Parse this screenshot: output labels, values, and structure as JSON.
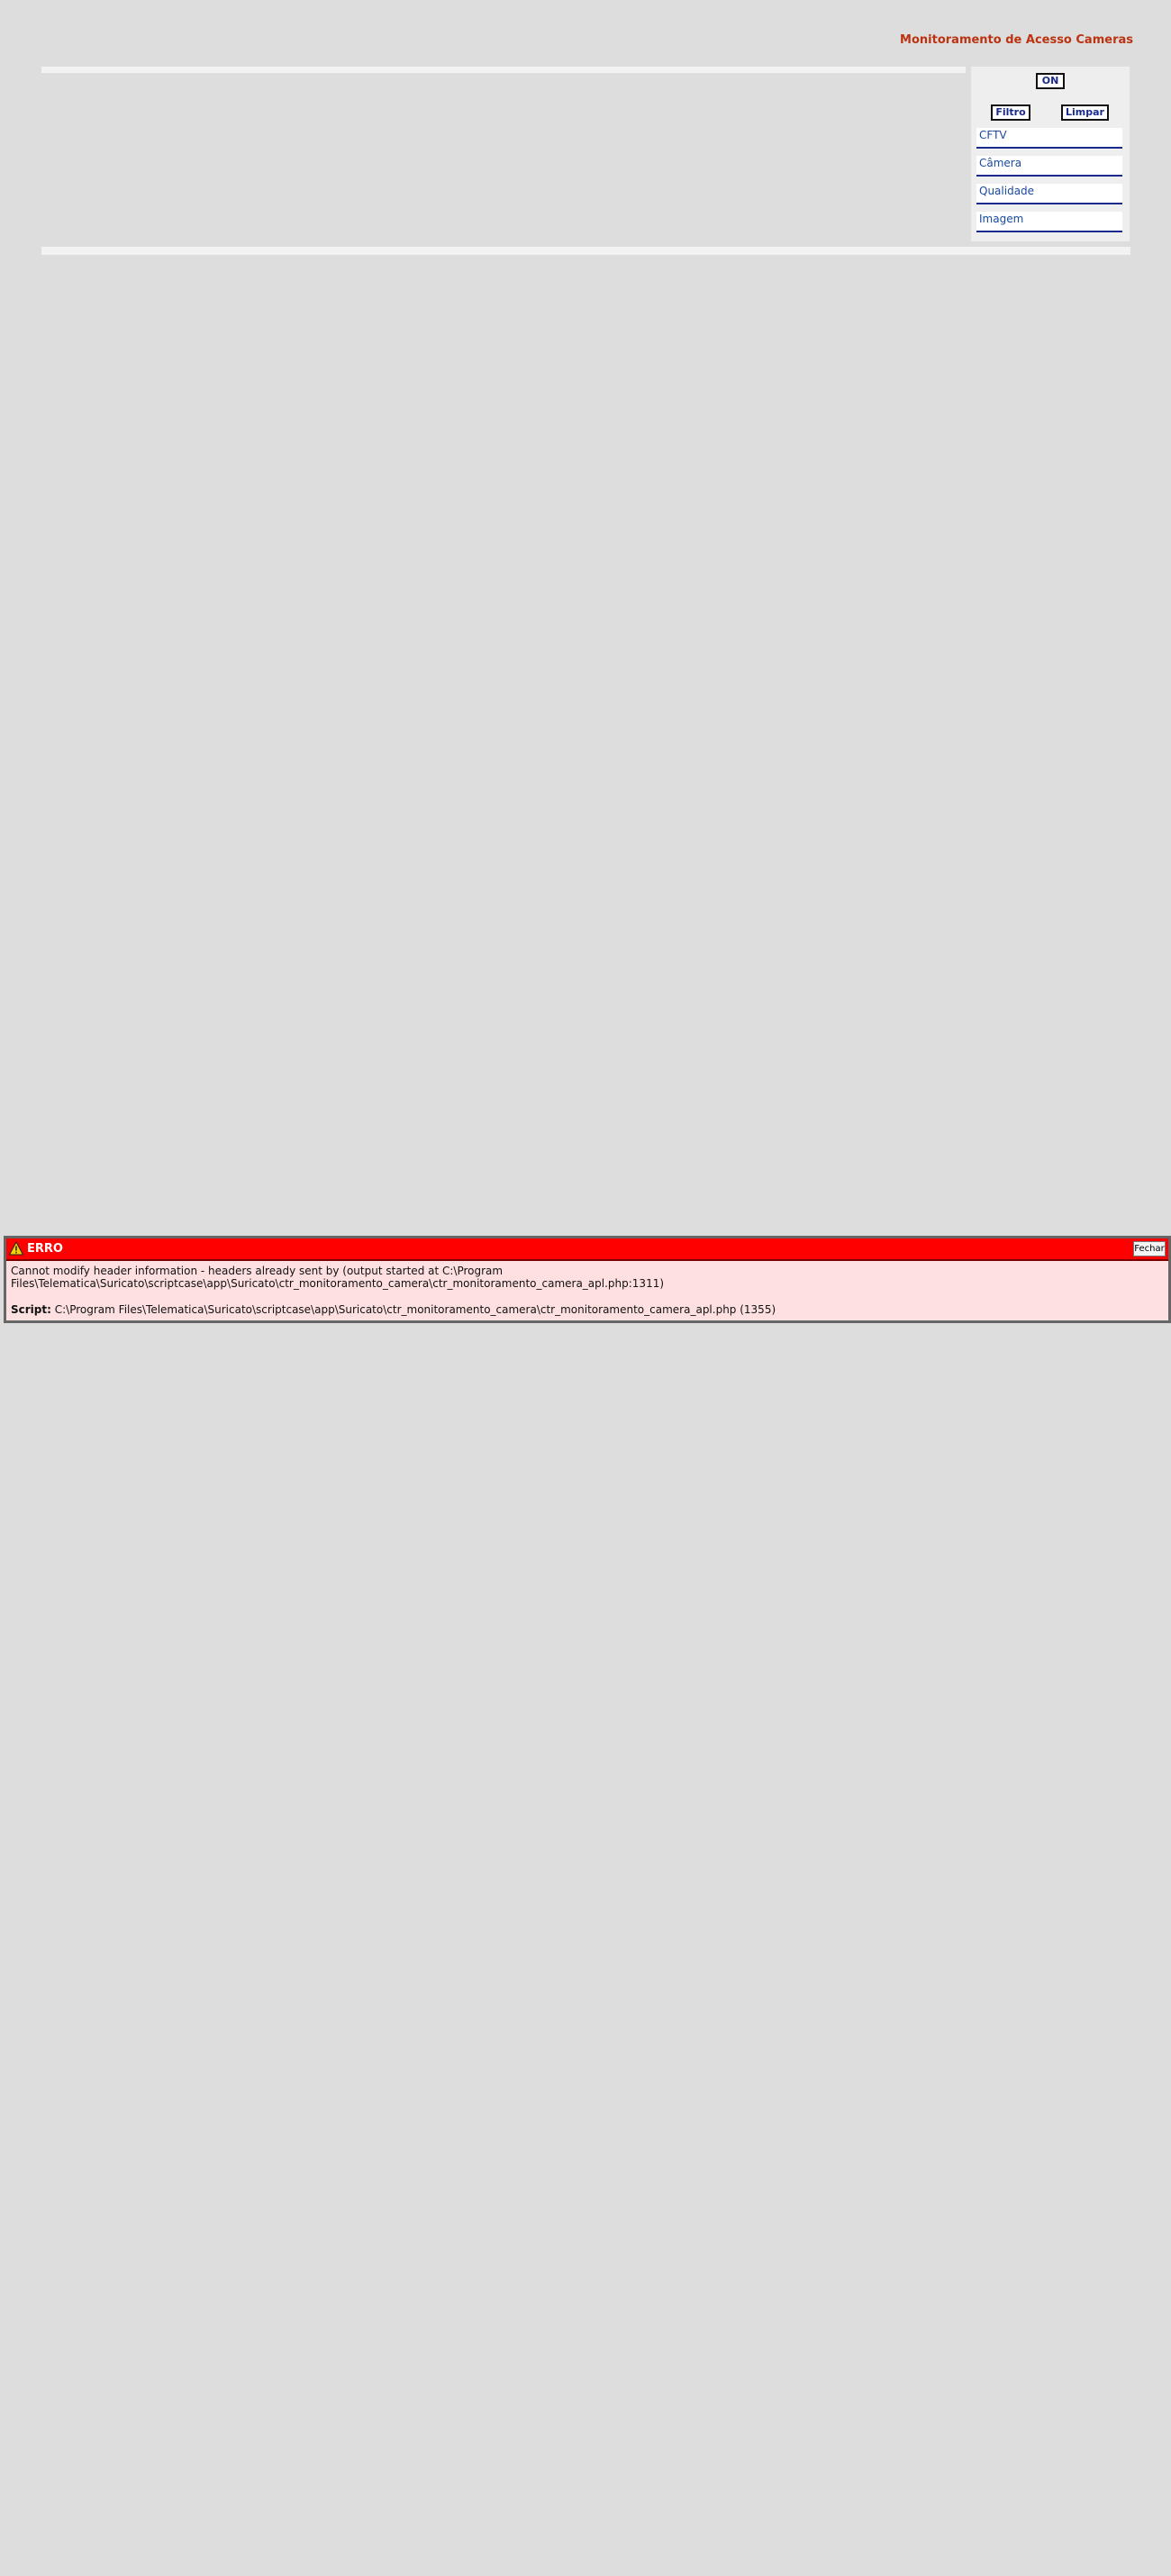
{
  "header": {
    "title": "Monitoramento de Acesso Cameras"
  },
  "filter_panel": {
    "on_button": "ON",
    "filter_button": "Filtro",
    "clear_button": "Limpar",
    "fields": [
      {
        "label": "CFTV"
      },
      {
        "label": "Câmera"
      },
      {
        "label": "Qualidade"
      },
      {
        "label": "Imagem"
      }
    ]
  },
  "error": {
    "icon": "warning-icon",
    "title": "ERRO",
    "close_label": "Fechar",
    "message_line1": "Cannot modify header information - headers already sent by (output started at C:\\Program",
    "message_line2": "Files\\Telematica\\Suricato\\scriptcase\\app\\Suricato\\ctr_monitoramento_camera\\ctr_monitoramento_camera_apl.php:1311)",
    "script_label": "Script:",
    "script_value": "C:\\Program Files\\Telematica\\Suricato\\scriptcase\\app\\Suricato\\ctr_monitoramento_camera\\ctr_monitoramento_camera_apl.php (1355)",
    "colors": {
      "header": "#ff0000",
      "body": "#ffe0e0"
    }
  },
  "colors": {
    "background": "#dddddd",
    "title": "#bb3311",
    "link": "#1a2a8c"
  }
}
